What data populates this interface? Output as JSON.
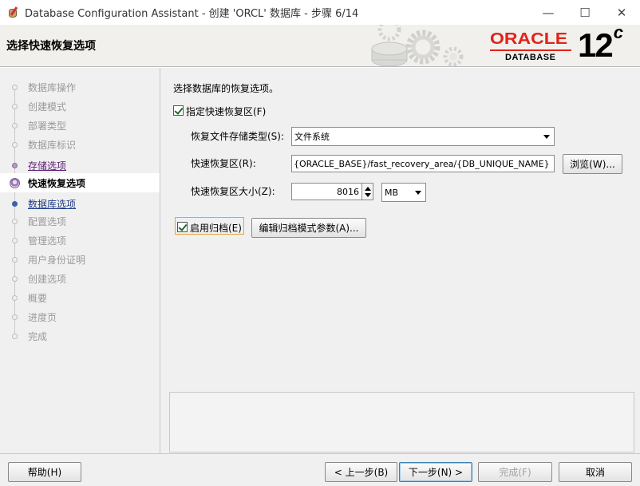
{
  "window": {
    "title": "Database Configuration Assistant - 创建 'ORCL' 数据库 - 步骤 6/14",
    "minimize": "—",
    "maximize": "☐",
    "close": "✕"
  },
  "header": {
    "title": "选择快速恢复选项",
    "brand": "ORACLE",
    "brand_sub": "DATABASE",
    "version": "12",
    "version_suffix": "c",
    "brand_color": "#e2231a"
  },
  "steps": [
    {
      "label": "数据库操作",
      "state": "done"
    },
    {
      "label": "创建模式",
      "state": "done"
    },
    {
      "label": "部署类型",
      "state": "done"
    },
    {
      "label": "数据库标识",
      "state": "done"
    },
    {
      "label": "存储选项",
      "state": "visited"
    },
    {
      "label": "快速恢复选项",
      "state": "active"
    },
    {
      "label": "数据库选项",
      "state": "link"
    },
    {
      "label": "配置选项",
      "state": "pending"
    },
    {
      "label": "管理选项",
      "state": "pending"
    },
    {
      "label": "用户身份证明",
      "state": "pending"
    },
    {
      "label": "创建选项",
      "state": "pending"
    },
    {
      "label": "概要",
      "state": "pending"
    },
    {
      "label": "进度页",
      "state": "pending"
    },
    {
      "label": "完成",
      "state": "pending"
    }
  ],
  "content": {
    "prompt": "选择数据库的恢复选项。",
    "fra_checkbox": {
      "label": "指定快速恢复区(F)",
      "checked": true
    },
    "storage_type": {
      "label": "恢复文件存储类型(S):",
      "value": "文件系统"
    },
    "fra_location": {
      "label": "快速恢复区(R):",
      "value": "{ORACLE_BASE}/fast_recovery_area/{DB_UNIQUE_NAME}",
      "browse": "浏览(W)..."
    },
    "fra_size": {
      "label": "快速恢复区大小(Z):",
      "value": "8016",
      "unit": "MB"
    },
    "archive_checkbox": {
      "label": "启用归档(E)",
      "checked": true
    },
    "edit_archive": "编辑归档模式参数(A)..."
  },
  "footer": {
    "help": "帮助(H)",
    "back": "< 上一步(B)",
    "next": "下一步(N) >",
    "finish": "完成(F)",
    "cancel": "取消"
  }
}
